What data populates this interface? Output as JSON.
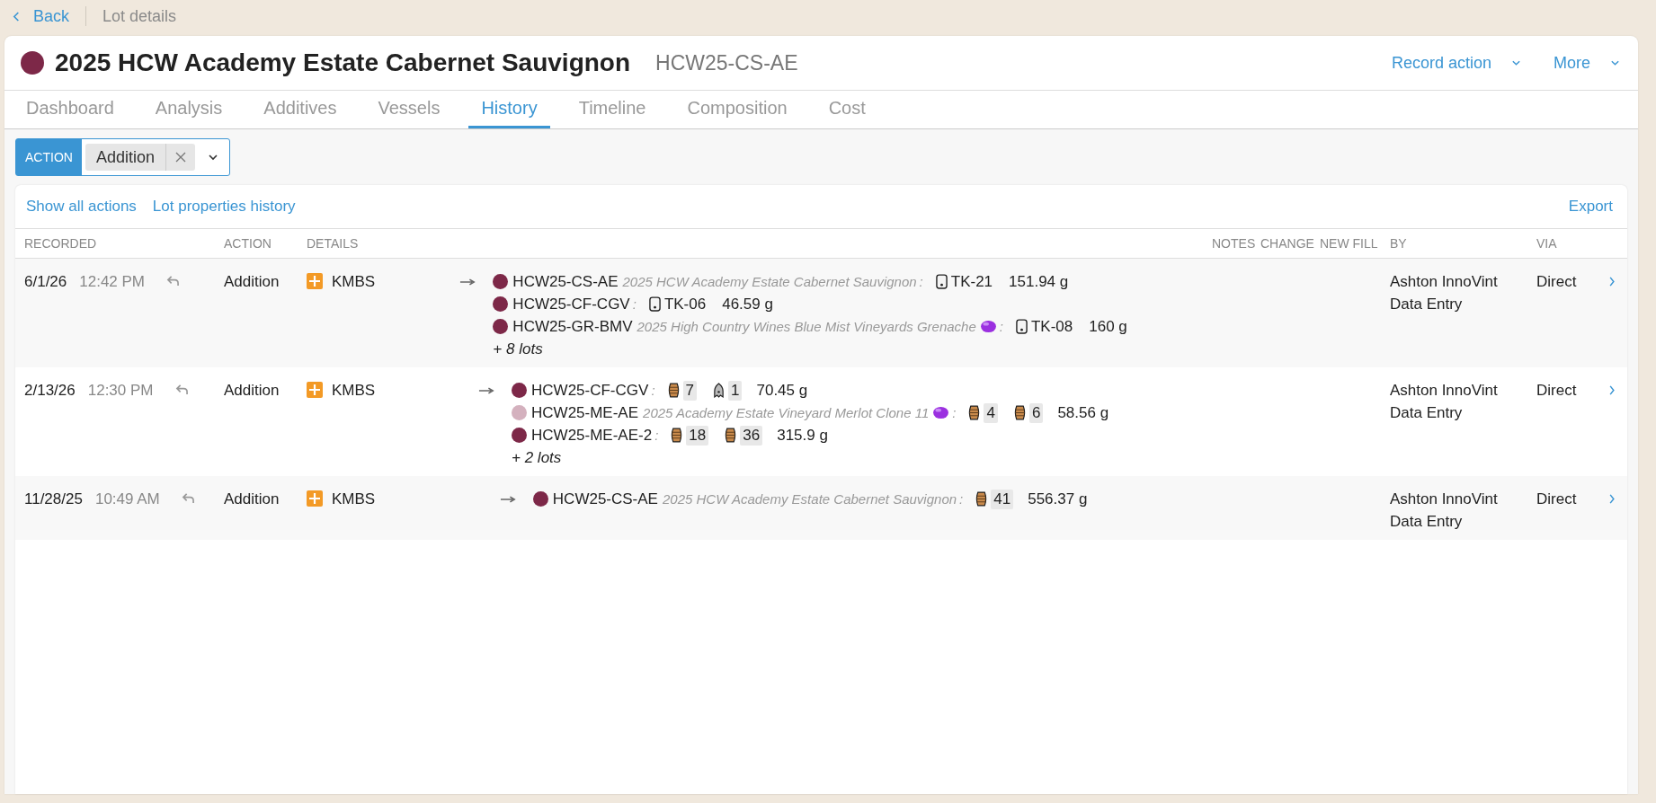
{
  "breadcrumb": {
    "back": "Back",
    "current": "Lot details"
  },
  "lot": {
    "color": "#7d2848",
    "name": "2025 HCW Academy Estate Cabernet Sauvignon",
    "code": "HCW25-CS-AE"
  },
  "header_actions": [
    {
      "label": "Record action"
    },
    {
      "label": "More"
    }
  ],
  "tabs": [
    {
      "label": "Dashboard",
      "selected": false
    },
    {
      "label": "Analysis",
      "selected": false
    },
    {
      "label": "Additives",
      "selected": false
    },
    {
      "label": "Vessels",
      "selected": false
    },
    {
      "label": "History",
      "selected": true
    },
    {
      "label": "Timeline",
      "selected": false
    },
    {
      "label": "Composition",
      "selected": false
    },
    {
      "label": "Cost",
      "selected": false
    }
  ],
  "filter": {
    "field": "ACTION",
    "value": "Addition"
  },
  "links": [
    {
      "label": "Show all actions"
    },
    {
      "label": "Lot properties history"
    }
  ],
  "export": "Export",
  "table": {
    "columns": [
      "RECORDED",
      "ACTION",
      "DETAILS",
      "NOTES",
      "CHANGE",
      "NEW FILL",
      "BY",
      "VIA"
    ],
    "rows": [
      {
        "date": "6/1/26",
        "time": "12:42 PM",
        "action": "Addition",
        "additive": "KMBS",
        "more": "+ 8 lots",
        "by": "Ashton InnoVint Data Entry",
        "via": "Direct",
        "lots": [
          {
            "code": "HCW25-CS-AE",
            "color": "#7d2848",
            "description": "2025 HCW Academy Estate Cabernet Sauvignon",
            "flagged": false,
            "separator": ":",
            "vessels": [
              {
                "kind": "tank",
                "label": "TK-21"
              }
            ],
            "amount": "151.94 g"
          },
          {
            "code": "HCW25-CF-CGV",
            "color": "#7d2848",
            "flagged": false,
            "separator": ":",
            "vessels": [
              {
                "kind": "tank",
                "label": "TK-06"
              }
            ],
            "amount": "46.59 g"
          },
          {
            "code": "HCW25-GR-BMV",
            "color": "#7d2848",
            "description": "2025 High Country Wines Blue Mist Vineyards Grenache",
            "flagged": true,
            "separator": ":",
            "vessels": [
              {
                "kind": "tank",
                "label": "TK-08"
              }
            ],
            "amount": "160 g"
          }
        ]
      },
      {
        "date": "2/13/26",
        "time": "12:30 PM",
        "action": "Addition",
        "additive": "KMBS",
        "more": "+ 2 lots",
        "by": "Ashton InnoVint Data Entry",
        "via": "Direct",
        "lots": [
          {
            "code": "HCW25-CF-CGV",
            "color": "#7d2848",
            "flagged": false,
            "separator": ":",
            "vessels": [
              {
                "kind": "barrel",
                "label": "7"
              },
              {
                "kind": "bin",
                "label": "1"
              }
            ],
            "amount": "70.45 g"
          },
          {
            "code": "HCW25-ME-AE",
            "color": "#d4b1be",
            "description": "2025 Academy Estate Vineyard Merlot Clone 11",
            "flagged": true,
            "separator": ":",
            "vessels": [
              {
                "kind": "barrel",
                "label": "4"
              },
              {
                "kind": "barrel",
                "label": "6"
              }
            ],
            "amount": "58.56 g"
          },
          {
            "code": "HCW25-ME-AE-2",
            "color": "#7d2848",
            "flagged": false,
            "separator": ":",
            "vessels": [
              {
                "kind": "barrel",
                "label": "18"
              },
              {
                "kind": "barrel",
                "label": "36"
              }
            ],
            "amount": "315.9 g"
          }
        ]
      },
      {
        "date": "11/28/25",
        "time": "10:49 AM",
        "action": "Addition",
        "additive": "KMBS",
        "by": "Ashton InnoVint Data Entry",
        "via": "Direct",
        "lots": [
          {
            "code": "HCW25-CS-AE",
            "color": "#7d2848",
            "description": "2025 HCW Academy Estate Cabernet Sauvignon",
            "flagged": false,
            "separator": ":",
            "vessels": [
              {
                "kind": "barrel",
                "label": "41"
              }
            ],
            "amount": "556.37 g"
          }
        ]
      }
    ]
  }
}
